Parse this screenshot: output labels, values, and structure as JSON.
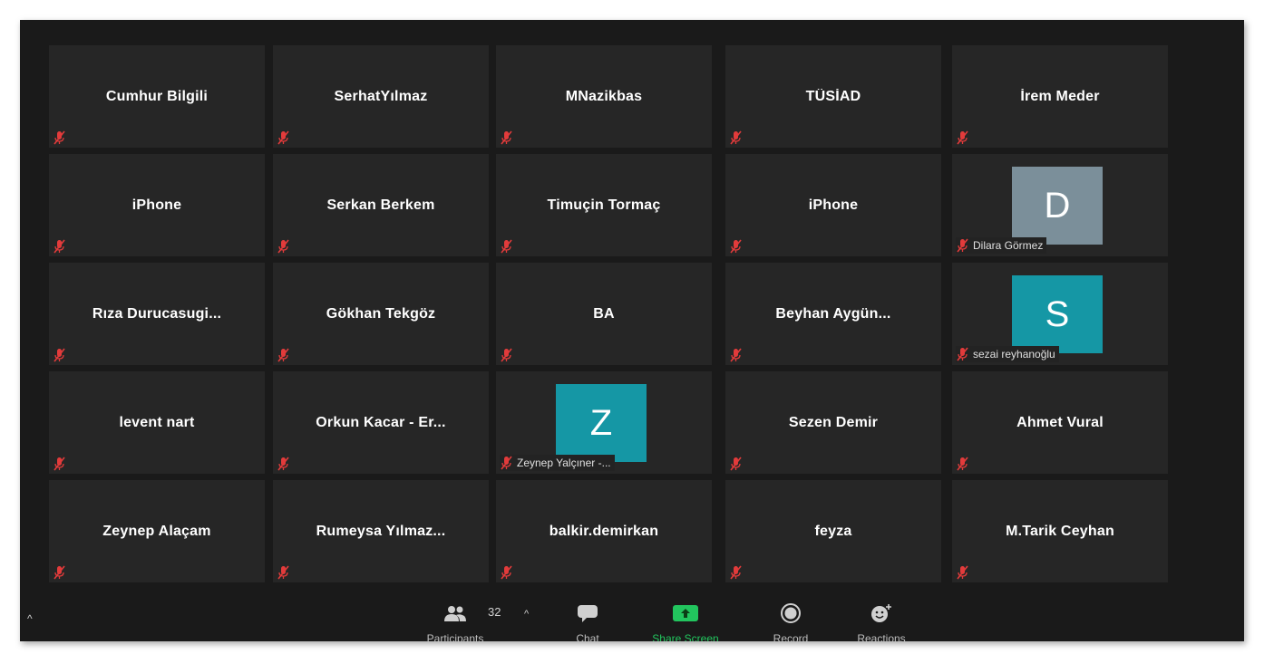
{
  "participants": [
    {
      "name": "Cumhur Bilgili"
    },
    {
      "name": "SerhatYılmaz"
    },
    {
      "name": "MNazikbas"
    },
    {
      "name": "TÜSİAD"
    },
    {
      "name": "İrem Meder"
    },
    {
      "name": "iPhone"
    },
    {
      "name": "Serkan Berkem"
    },
    {
      "name": "Timuçin Tormaç"
    },
    {
      "name": "iPhone"
    },
    {
      "name": "Dilara Görmez",
      "avatar": {
        "letter": "D",
        "color": "#7b8f9a"
      }
    },
    {
      "name": "Rıza  Durucasugi..."
    },
    {
      "name": "Gökhan Tekgöz"
    },
    {
      "name": "BA"
    },
    {
      "name": "Beyhan Aygün..."
    },
    {
      "name": "sezai reyhanoğlu",
      "avatar": {
        "letter": "S",
        "color": "#1597a5"
      }
    },
    {
      "name": "levent nart"
    },
    {
      "name": "Orkun Kacar - Er..."
    },
    {
      "name": "Zeynep Yalçıner -...",
      "avatar": {
        "letter": "Z",
        "color": "#1597a5"
      }
    },
    {
      "name": "Sezen Demir"
    },
    {
      "name": "Ahmet Vural"
    },
    {
      "name": "Zeynep Alaçam"
    },
    {
      "name": "Rumeysa  Yılmaz..."
    },
    {
      "name": "balkir.demirkan"
    },
    {
      "name": "feyza"
    },
    {
      "name": "M.Tarik Ceyhan"
    }
  ],
  "toolbar": {
    "participants_label": "Participants",
    "participants_count": "32",
    "chat_label": "Chat",
    "share_label": "Share Screen",
    "record_label": "Record",
    "reactions_label": "Reactions",
    "share_color": "#22c55e"
  },
  "icons": {
    "muted_mic": "muted-mic-icon",
    "participants": "participants-icon",
    "chat": "chat-icon",
    "share": "share-screen-icon",
    "record": "record-icon",
    "reactions": "reactions-icon"
  }
}
